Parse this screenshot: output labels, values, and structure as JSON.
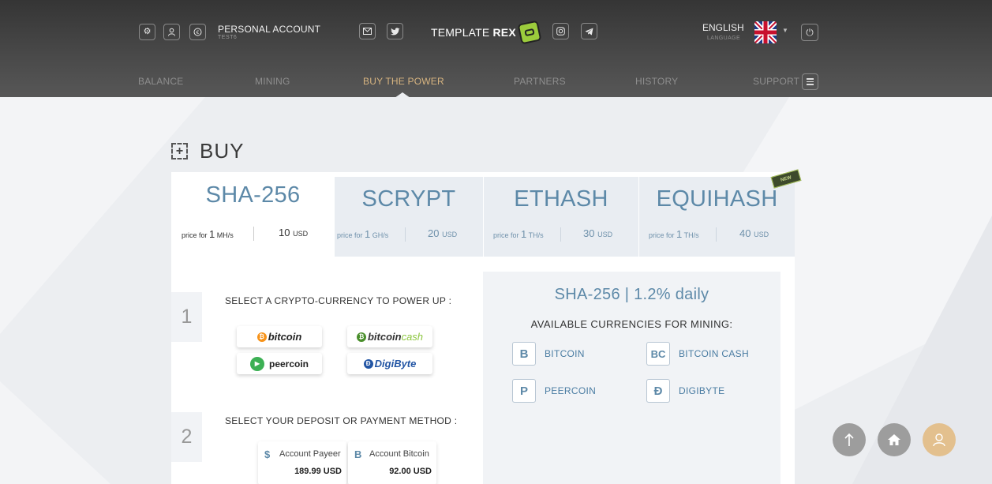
{
  "header": {
    "account_title": "PERSONAL ACCOUNT",
    "account_user": "TEST6",
    "logo_text": "TEMPLATE",
    "logo_bold": "REX",
    "language": "ENGLISH",
    "language_label": "LANGUAGE",
    "icons": [
      "gear-icon",
      "user-icon",
      "coin-icon",
      "mail-icon",
      "twitter-icon",
      "instagram-icon",
      "telegram-icon",
      "power-icon",
      "menu-icon"
    ]
  },
  "nav": {
    "balance": "BALANCE",
    "mining": "MINING",
    "buy": "BUY THE POWER",
    "partners": "PARTNERS",
    "history": "HISTORY",
    "support": "SUPPORT"
  },
  "page": {
    "title": "BUY",
    "new_badge": "NEW"
  },
  "tabs": [
    {
      "name": "SHA-256",
      "price_for": "price for",
      "amount": "1",
      "unit": "MH/s",
      "value": "10",
      "currency": "USD"
    },
    {
      "name": "SCRYPT",
      "price_for": "price for",
      "amount": "1",
      "unit": "GH/s",
      "value": "20",
      "currency": "USD"
    },
    {
      "name": "ETHASH",
      "price_for": "price for",
      "amount": "1",
      "unit": "TH/s",
      "value": "30",
      "currency": "USD"
    },
    {
      "name": "EQUIHASH",
      "price_for": "price for",
      "amount": "1",
      "unit": "TH/s",
      "value": "40",
      "currency": "USD"
    }
  ],
  "steps": {
    "step1_num": "1",
    "step1_text": "SELECT A CRYPTO-CURRENCY TO POWER UP :",
    "step2_num": "2",
    "step2_text": "SELECT YOUR DEPOSIT OR PAYMENT METHOD :"
  },
  "coins": {
    "bitcoin": "bitcoin",
    "bitcoincash_a": "bitcoin",
    "bitcoincash_b": "cash",
    "peercoin": "peercoin",
    "digibyte_a": "Digi",
    "digibyte_b": "Byte"
  },
  "payments": [
    {
      "label": "Account Payeer",
      "value": "189.99 USD",
      "symbol": "$"
    },
    {
      "label": "Account Bitcoin",
      "value": "92.00 USD",
      "symbol": "B"
    }
  ],
  "panel": {
    "title": "SHA-256 | 1.2% daily",
    "subtitle": "AVAILABLE CURRENCIES FOR MINING:",
    "currencies": [
      {
        "name": "BITCOIN",
        "symbol": "B"
      },
      {
        "name": "BITCOIN CASH",
        "symbol": "BC"
      },
      {
        "name": "PEERCOIN",
        "symbol": "P"
      },
      {
        "name": "DIGIBYTE",
        "symbol": "Ð"
      }
    ]
  },
  "colors": {
    "accent": "#d7b480",
    "blue": "#5d89a8",
    "header": "#4a4a4a"
  }
}
